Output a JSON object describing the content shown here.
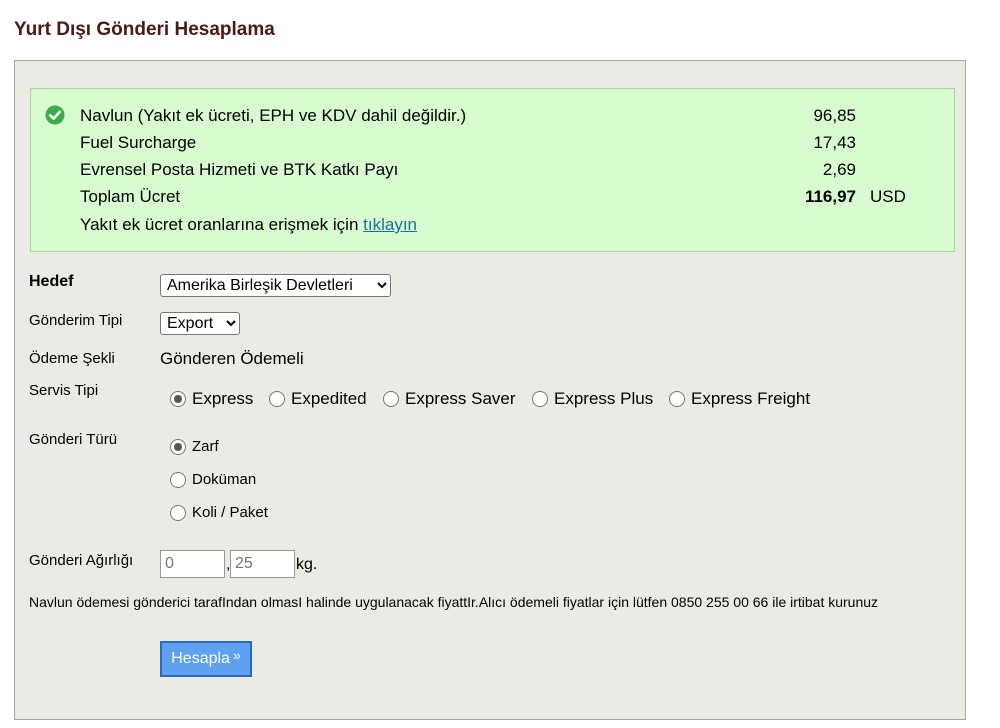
{
  "title": "Yurt Dışı Gönderi Hesaplama",
  "result": {
    "rows": [
      {
        "label": "Navlun (Yakıt ek ücreti, EPH ve KDV dahil değildir.)",
        "value": "96,85"
      },
      {
        "label": "Fuel Surcharge",
        "value": "17,43"
      },
      {
        "label": "Evrensel Posta Hizmeti ve BTK Katkı Payı",
        "value": "2,69"
      },
      {
        "label": "Toplam Ücret",
        "value": "116,97",
        "currency": "USD"
      }
    ],
    "link_text_prefix": "Yakıt ek ücret oranlarına erişmek için",
    "link_label": "tıklayın",
    "accent_color": "#d8fcd0"
  },
  "form": {
    "hedef_label": "Hedef",
    "hedef_value": "Amerika Birleşik Devletleri",
    "gonderim_tipi_label": "Gönderim Tipi",
    "gonderim_tipi_value": "Export",
    "odeme_label": "Ödeme Şekli",
    "odeme_value": "Gönderen Ödemeli",
    "servis_label": "Servis Tipi",
    "servis_options": [
      "Express",
      "Expedited",
      "Express Saver",
      "Express Plus",
      "Express Freight"
    ],
    "servis_selected": "Express",
    "turu_label": "Gönderi Türü",
    "turu_options": [
      "Zarf",
      "Doküman",
      "Koli / Paket"
    ],
    "turu_selected": "Zarf",
    "agirlik_label": "Gönderi Ağırlığı",
    "agirlik_whole_placeholder": "0",
    "agirlik_decimal_placeholder": "25",
    "agirlik_comma": ",",
    "agirlik_unit": "kg.",
    "note": "Navlun ödemesi gönderici tarafIndan olmasI halinde uygulanacak fiyattIr.Alıcı ödemeli fiyatlar için lütfen 0850 255 00 66 ile irtibat kurunuz",
    "button_label": "Hesapla",
    "button_chevron": "»",
    "button_color": "#5fa0f0"
  }
}
